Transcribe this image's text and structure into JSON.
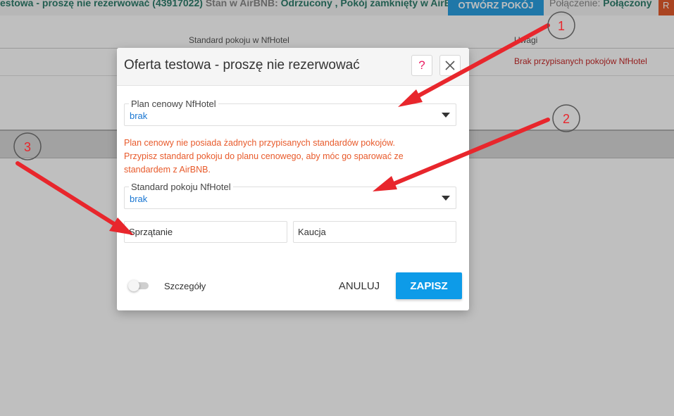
{
  "topbar": {
    "offer_text": "estowa - proszę nie rezerwować (43917022)",
    "status_label": "Stan w AirBNB:",
    "status_value": "Odrzucony , Pokój zamknięty w AirBNB",
    "open_room_button": "OTWÓRZ POKÓJ",
    "connection_label": "Połączenie:",
    "connection_value": "Połączony",
    "r_button": "R"
  },
  "table": {
    "col_standard": "Standard pokoju w NfHotel",
    "col_notes": "Uwagi",
    "row_note": "Brak przypisanych pokojów NfHotel"
  },
  "modal": {
    "title": "Oferta testowa - proszę nie rezerwować",
    "help_glyph": "?",
    "rate_plan": {
      "label": "Plan cenowy NfHotel",
      "value": "brak"
    },
    "warning_lines": [
      "Plan cenowy nie posiada żadnych przypisanych standardów pokojów.",
      "Przypisz standard pokoju do planu cenowego, aby móc go sparować ze",
      "standardem z AirBNB."
    ],
    "room_standard": {
      "label": "Standard pokoju NfHotel",
      "value": "brak"
    },
    "cleaning_placeholder": "Sprzątanie",
    "deposit_placeholder": "Kaucja",
    "details_label": "Szczegóły",
    "details_toggle_on": false,
    "cancel_label": "ANULUJ",
    "save_label": "ZAPISZ"
  },
  "annotations": {
    "color": "#e8262c",
    "labels": [
      "1",
      "2",
      "3"
    ]
  }
}
